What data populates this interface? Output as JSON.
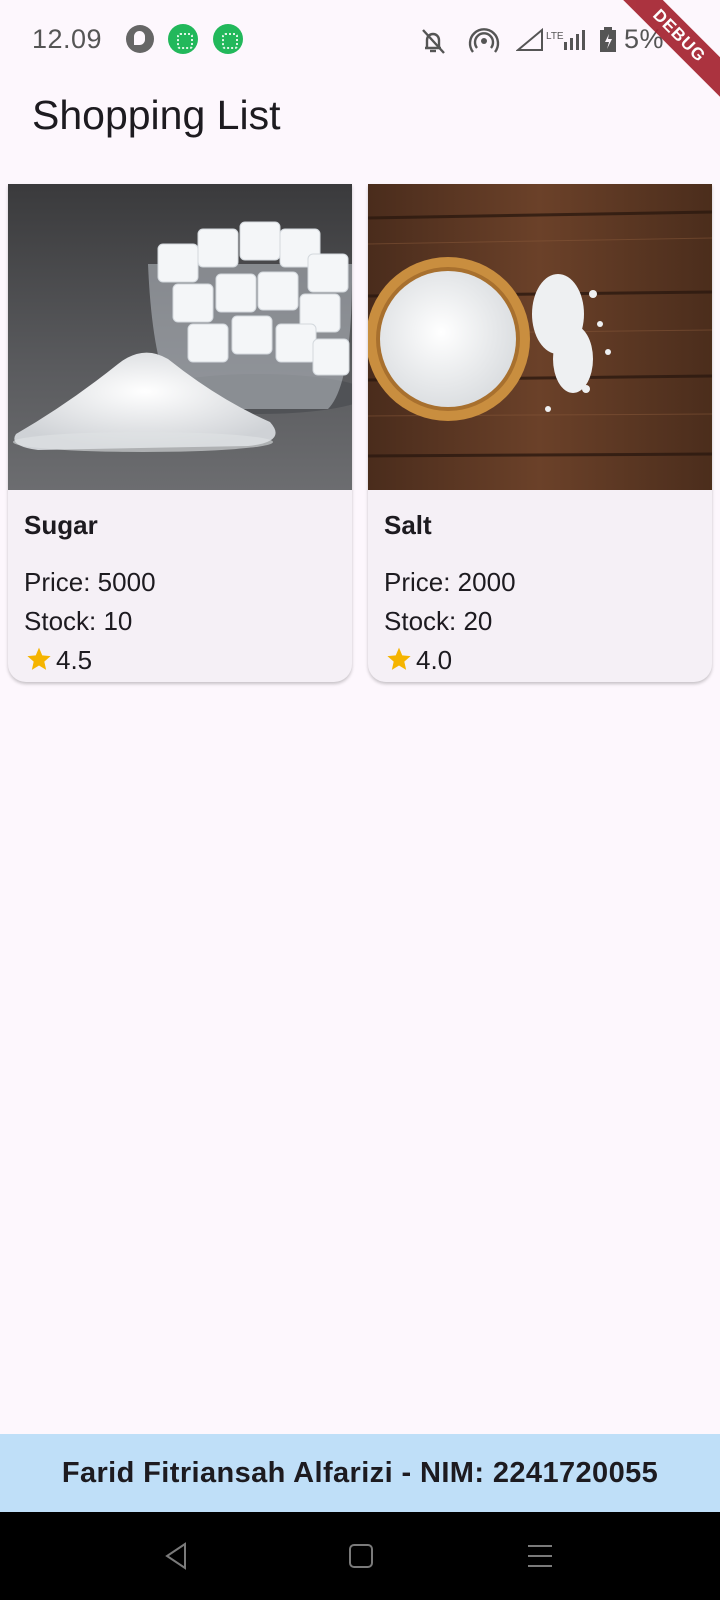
{
  "status_bar": {
    "time": "12.09",
    "battery": "5%",
    "icons": [
      "notification-p-icon",
      "notification-app-icon",
      "notification-app-icon",
      "bell-off-icon",
      "hotspot-icon",
      "signal-icon",
      "lte-signal-icon",
      "battery-icon"
    ]
  },
  "debug_banner": "DEBUG",
  "app_bar": {
    "title": "Shopping List"
  },
  "products": [
    {
      "name": "Sugar",
      "price": "Price: 5000",
      "stock": "Stock: 10",
      "rating": "4.5",
      "image": "sugar-photo"
    },
    {
      "name": "Salt",
      "price": "Price: 2000",
      "stock": "Stock: 20",
      "rating": "4.0",
      "image": "salt-photo"
    }
  ],
  "footer": {
    "text": "Farid Fitriansah Alfarizi - NIM: 2241720055"
  },
  "colors": {
    "background": "#fdf7fd",
    "card": "#f5f0f6",
    "footer": "#bfdff8",
    "star": "#f5b400"
  },
  "nav_bar": {
    "buttons": [
      "back-icon",
      "home-icon",
      "recents-icon"
    ]
  }
}
